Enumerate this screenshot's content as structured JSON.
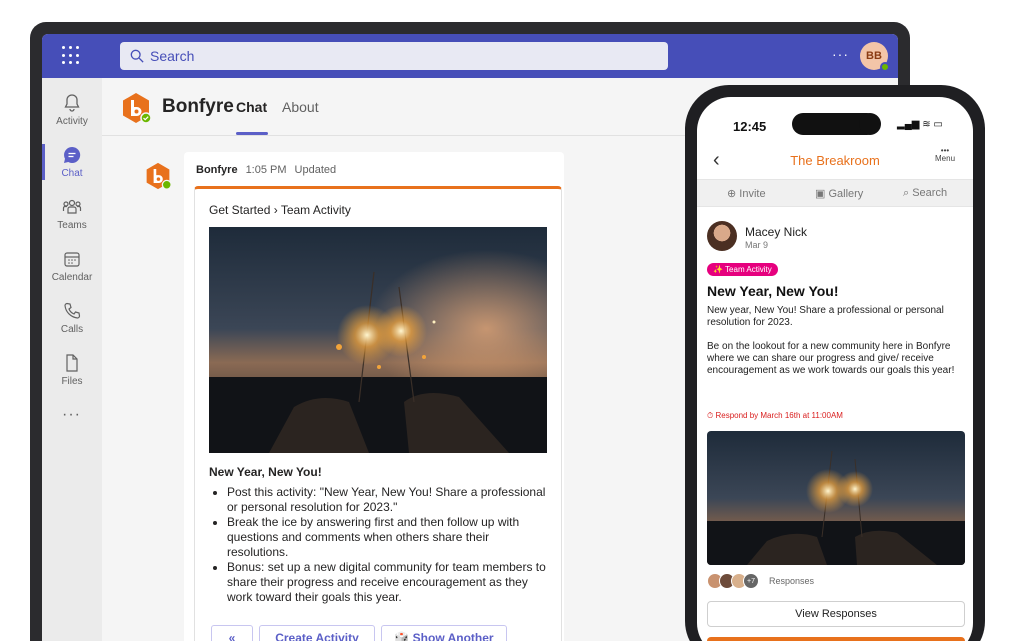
{
  "teams": {
    "search_placeholder": "Search",
    "more": "···",
    "user_initials": "BB",
    "rail": [
      {
        "label": "Activity",
        "icon": "bell-icon"
      },
      {
        "label": "Chat",
        "icon": "chat-icon"
      },
      {
        "label": "Teams",
        "icon": "teams-icon"
      },
      {
        "label": "Calendar",
        "icon": "calendar-icon"
      },
      {
        "label": "Calls",
        "icon": "phone-icon"
      },
      {
        "label": "Files",
        "icon": "file-icon"
      }
    ],
    "rail_more": "···"
  },
  "app": {
    "name": "Bonfyre",
    "tabs": [
      "Chat",
      "About"
    ],
    "active_tab": "Chat"
  },
  "message": {
    "sender": "Bonfyre",
    "time": "1:05 PM",
    "status": "Updated",
    "breadcrumb": "Get Started  ›  Team Activity",
    "title": "New Year, New You!",
    "bullets": [
      "Post this activity: \"New Year, New You! Share a professional or personal resolution for 2023.\"",
      "Break the ice by answering first and then follow up with questions and comments when others share their resolutions.",
      "Bonus: set up a new digital community for team members to share their progress and receive encouragement as they work toward their goals this year."
    ],
    "buttons": {
      "back": "«",
      "create": "Create Activity",
      "show_another": "🎲 Show Another"
    }
  },
  "phone": {
    "time": "12:45",
    "status_icons": "▂▄▆ ≋ ▭",
    "back": "‹",
    "title": "The Breakroom",
    "menu_dots": "•••",
    "menu_label": "Menu",
    "subnav": {
      "invite": "⊕ Invite",
      "gallery": "▣ Gallery",
      "search": "⌕ Search"
    },
    "author": "Macey Nick",
    "date": "Mar 9",
    "tag": "✨ Team Activity",
    "post_title": "New Year, New You!",
    "paragraph1": "New year, New You! Share a professional or personal resolution for 2023.",
    "paragraph2": "Be on the lookout for a new community here in Bonfyre where we can share our progress and give/ receive encouragement as we work towards our goals this year!",
    "respond": "⏱ Respond by March 16th at 11:00AM",
    "responder_count": "+7",
    "responses_label": "Responses",
    "view_button": "View Responses"
  },
  "colors": {
    "teams_purple": "#464eb8",
    "accent": "#5b5fc7",
    "bonfyre_orange": "#e8711c",
    "tag_pink": "#e6007e"
  }
}
